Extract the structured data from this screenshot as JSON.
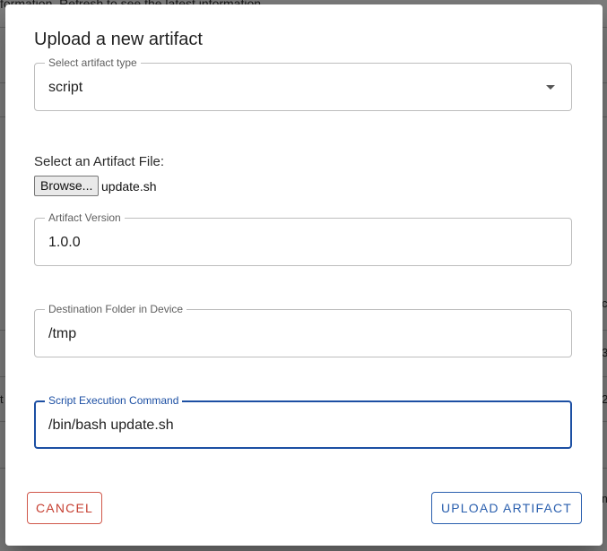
{
  "background": {
    "banner_text": "formation. Refresh to see the latest information.",
    "edge_glyphs": [
      "c",
      "3",
      "2",
      "m"
    ],
    "left_glyph": "t"
  },
  "dialog": {
    "title": "Upload a new artifact",
    "artifact_type": {
      "label": "Select artifact type",
      "value": "script"
    },
    "file": {
      "label": "Select an Artifact File:",
      "browse_label": "Browse...",
      "file_name": "update.sh"
    },
    "version": {
      "label": "Artifact Version",
      "value": "1.0.0"
    },
    "destination": {
      "label": "Destination Folder in Device",
      "value": "/tmp"
    },
    "command": {
      "label": "Script Execution Command",
      "value": "/bin/bash update.sh"
    },
    "actions": {
      "cancel": "Cancel",
      "upload": "Upload Artifact"
    }
  },
  "colors": {
    "accent": "#1c4fa3",
    "danger": "#c63f31",
    "overlay": "rgba(0,0,0,0.5)"
  }
}
